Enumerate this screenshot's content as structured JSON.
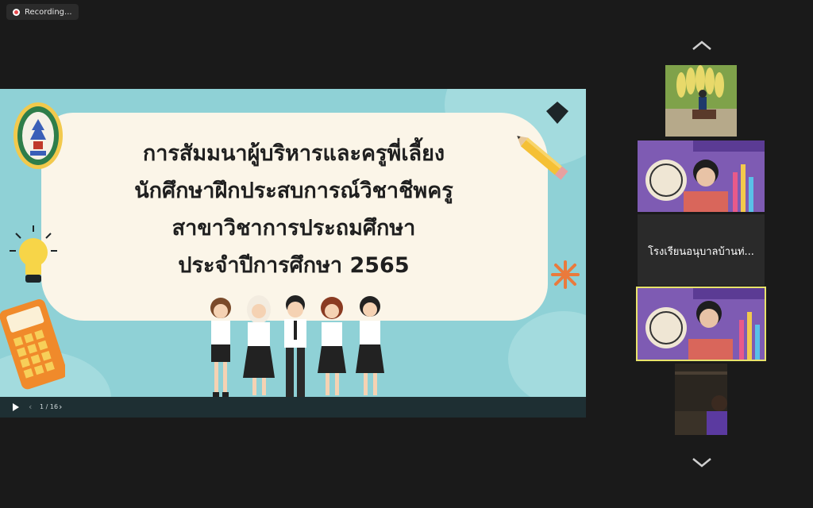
{
  "recording": {
    "label": "Recording..."
  },
  "slide": {
    "title_lines": [
      "การสัมมนาผู้บริหารและครูพี่เลี้ยง",
      "นักศึกษาฝึกประสบการณ์วิชาชีพครู",
      "สาขาวิชาการประถมศึกษา",
      "ประจำปีการศึกษา 2565"
    ]
  },
  "presentation_controls": {
    "page_indicator": "1 / 16"
  },
  "participants": {
    "tiles": [
      {
        "type": "video",
        "scene": "outdoor-banana-sculpture"
      },
      {
        "type": "video",
        "scene": "virtual-background-elementary-education"
      },
      {
        "type": "name",
        "name": "โรงเรียนอนุบาลบ้านท่..."
      },
      {
        "type": "video",
        "scene": "virtual-background-elementary-education",
        "active_speaker": true
      },
      {
        "type": "video",
        "scene": "dim-room"
      }
    ]
  },
  "colors": {
    "slide_bg": "#8fd1d6",
    "active_speaker_border": "#e8e36b",
    "recording_dot": "#e5484d"
  }
}
